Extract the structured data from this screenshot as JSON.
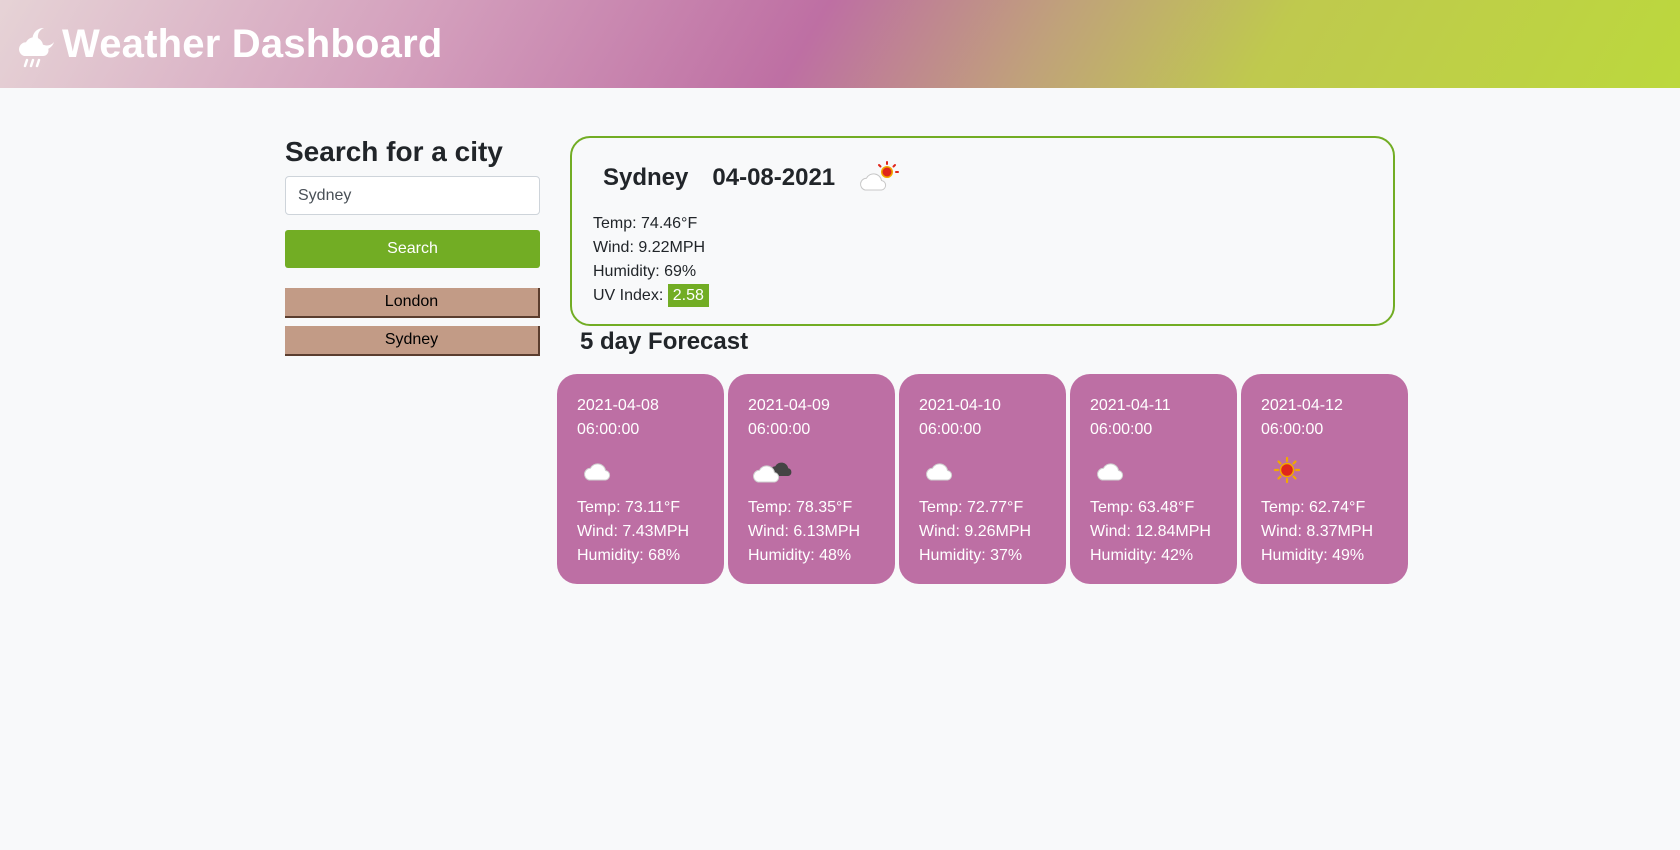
{
  "header": {
    "title": "Weather Dashboard",
    "icon": "cloud-moon-rain-icon"
  },
  "sidebar": {
    "heading": "Search for a city",
    "search_value": "Sydney",
    "search_button": "Search",
    "history": [
      {
        "label": "London"
      },
      {
        "label": "Sydney"
      }
    ]
  },
  "current": {
    "city": "Sydney",
    "date": "04-08-2021",
    "icon": "partly-cloudy-icon",
    "temp_label": "Temp: 74.46°F",
    "wind_label": "Wind: 9.22MPH",
    "humidity_label": "Humidity: 69%",
    "uv_prefix": "UV Index:",
    "uv_value": "2.58"
  },
  "forecast": {
    "title": "5 day Forecast",
    "days": [
      {
        "date": "2021-04-08",
        "time": "06:00:00",
        "icon": "cloud-icon",
        "temp": "Temp: 73.11°F",
        "wind": "Wind: 7.43MPH",
        "humidity": "Humidity: 68%"
      },
      {
        "date": "2021-04-09",
        "time": "06:00:00",
        "icon": "dark-cloud-icon",
        "temp": "Temp: 78.35°F",
        "wind": "Wind: 6.13MPH",
        "humidity": "Humidity: 48%"
      },
      {
        "date": "2021-04-10",
        "time": "06:00:00",
        "icon": "cloud-icon",
        "temp": "Temp: 72.77°F",
        "wind": "Wind: 9.26MPH",
        "humidity": "Humidity: 37%"
      },
      {
        "date": "2021-04-11",
        "time": "06:00:00",
        "icon": "cloud-icon",
        "temp": "Temp: 63.48°F",
        "wind": "Wind: 12.84MPH",
        "humidity": "Humidity: 42%"
      },
      {
        "date": "2021-04-12",
        "time": "06:00:00",
        "icon": "sun-icon",
        "temp": "Temp: 62.74°F",
        "wind": "Wind: 8.37MPH",
        "humidity": "Humidity: 49%"
      }
    ]
  },
  "colors": {
    "accent_green": "#72ad24",
    "card_pink": "#bd6fa4",
    "history_tan": "#c29b86"
  }
}
